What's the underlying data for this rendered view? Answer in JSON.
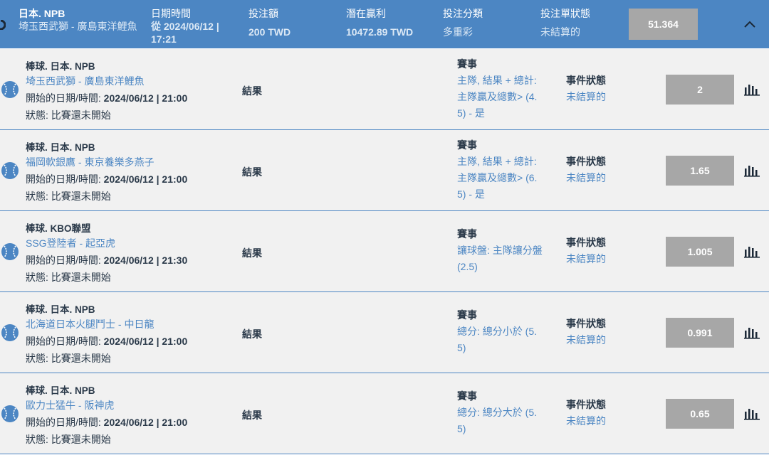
{
  "header": {
    "league": "日本. NPB",
    "teams": "埼玉西武獅 - 廣島東洋鯉魚",
    "date_label": "日期時間",
    "date_value": "從 2024/06/12 | 17:21",
    "amount_label": "投注額",
    "amount_value": "200 TWD",
    "win_label": "潛在贏利",
    "win_value": "10472.89 TWD",
    "type_label": "投注分類",
    "type_value": "多重彩",
    "status_label": "投注單狀態",
    "status_value": "未結算的",
    "odds": "51.364",
    "toggle_icon": "chevron-up-icon",
    "accent": "#4c86c3"
  },
  "rows": [
    {
      "league": "棒球. 日本. NPB",
      "teams": "埼玉西武獅 - 廣島東洋鯉魚",
      "start_label": "開始的日期/時間:",
      "start_value": "2024/06/12 | 21:00",
      "state": "狀態: 比賽還未開始",
      "result": "結果",
      "event_title": "賽事",
      "event_lines": [
        "主隊, 結果 + 總計:",
        "主隊贏及總數> (4.",
        "5) - 是"
      ],
      "event_status_label": "事件狀態",
      "event_status_value": "未結算的",
      "odds": "2"
    },
    {
      "league": "棒球. 日本. NPB",
      "teams": "福岡軟銀鷹 - 東京養樂多燕子",
      "start_label": "開始的日期/時間:",
      "start_value": "2024/06/12 | 21:00",
      "state": "狀態: 比賽還未開始",
      "result": "結果",
      "event_title": "賽事",
      "event_lines": [
        "主隊, 結果 + 總計:",
        "主隊贏及總數> (6.",
        "5) - 是"
      ],
      "event_status_label": "事件狀態",
      "event_status_value": "未結算的",
      "odds": "1.65"
    },
    {
      "league": "棒球. KBO聯盟",
      "teams": "SSG登陸者 - 起亞虎",
      "start_label": "開始的日期/時間:",
      "start_value": "2024/06/12 | 21:30",
      "state": "狀態: 比賽還未開始",
      "result": "結果",
      "event_title": "賽事",
      "event_lines": [
        "讓球盤: 主隊讓分盤",
        "(2.5)"
      ],
      "event_status_label": "事件狀態",
      "event_status_value": "未結算的",
      "odds": "1.005"
    },
    {
      "league": "棒球. 日本. NPB",
      "teams": "北海道日本火腿鬥士 - 中日龍",
      "start_label": "開始的日期/時間:",
      "start_value": "2024/06/12 | 21:00",
      "state": "狀態: 比賽還未開始",
      "result": "結果",
      "event_title": "賽事",
      "event_lines": [
        "總分: 總分小於 (5.",
        "5)"
      ],
      "event_status_label": "事件狀態",
      "event_status_value": "未結算的",
      "odds": "0.991"
    },
    {
      "league": "棒球. 日本. NPB",
      "teams": "歐力士猛牛 - 阪神虎",
      "start_label": "開始的日期/時間:",
      "start_value": "2024/06/12 | 21:00",
      "state": "狀態: 比賽還未開始",
      "result": "結果",
      "event_title": "賽事",
      "event_lines": [
        "總分: 總分大於 (5.",
        "5)"
      ],
      "event_status_label": "事件狀態",
      "event_status_value": "未結算的",
      "odds": "0.65"
    }
  ]
}
